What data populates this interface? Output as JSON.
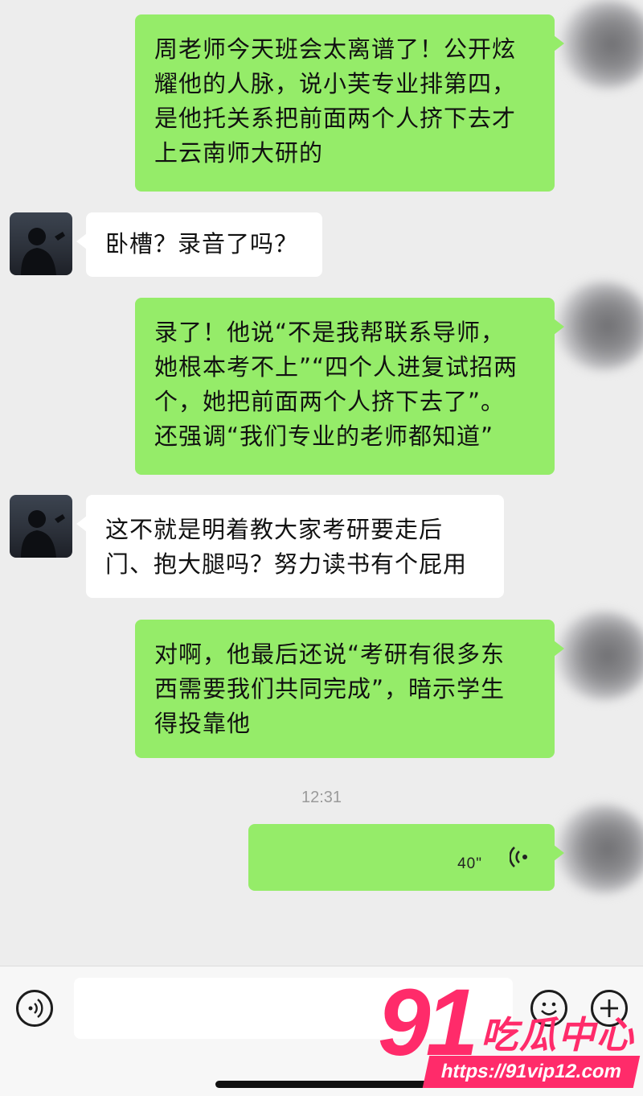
{
  "messages": [
    {
      "side": "me",
      "text": "周老师今天班会太离谱了！公开炫\n耀他的人脉，说小芙专业排第四，\n是他托关系把前面两个人挤下去才\n上云南师大研的"
    },
    {
      "side": "other",
      "text": "卧槽？录音了吗？"
    },
    {
      "side": "me",
      "text": "录了！他说“不是我帮联系导师，\n她根本考不上”“四个人进复试招两\n个，她把前面两个人挤下去了”。\n还强调“我们专业的老师都知道”"
    },
    {
      "side": "other",
      "text": "这不就是明着教大家考研要走后\n门、抱大腿吗？努力读书有个屁用"
    },
    {
      "side": "me",
      "text": "对啊，他最后还说“考研有很多东\n西需要我们共同完成”，暗示学生\n得投靠他"
    }
  ],
  "timestamp": "12:31",
  "voice_message": {
    "duration": "40\"",
    "icon": "voice-wave-icon"
  },
  "input_bar": {
    "voice_icon": "voice-input-icon",
    "emoji_icon": "emoji-icon",
    "plus_icon": "plus-icon",
    "placeholder": ""
  },
  "watermark": {
    "number": "91",
    "name": "吃瓜中心",
    "url": "https://91vip12.com"
  },
  "colors": {
    "sent_bubble": "#95ec69",
    "received_bubble": "#ffffff",
    "background": "#ededed",
    "watermark": "#ff2b6a"
  }
}
